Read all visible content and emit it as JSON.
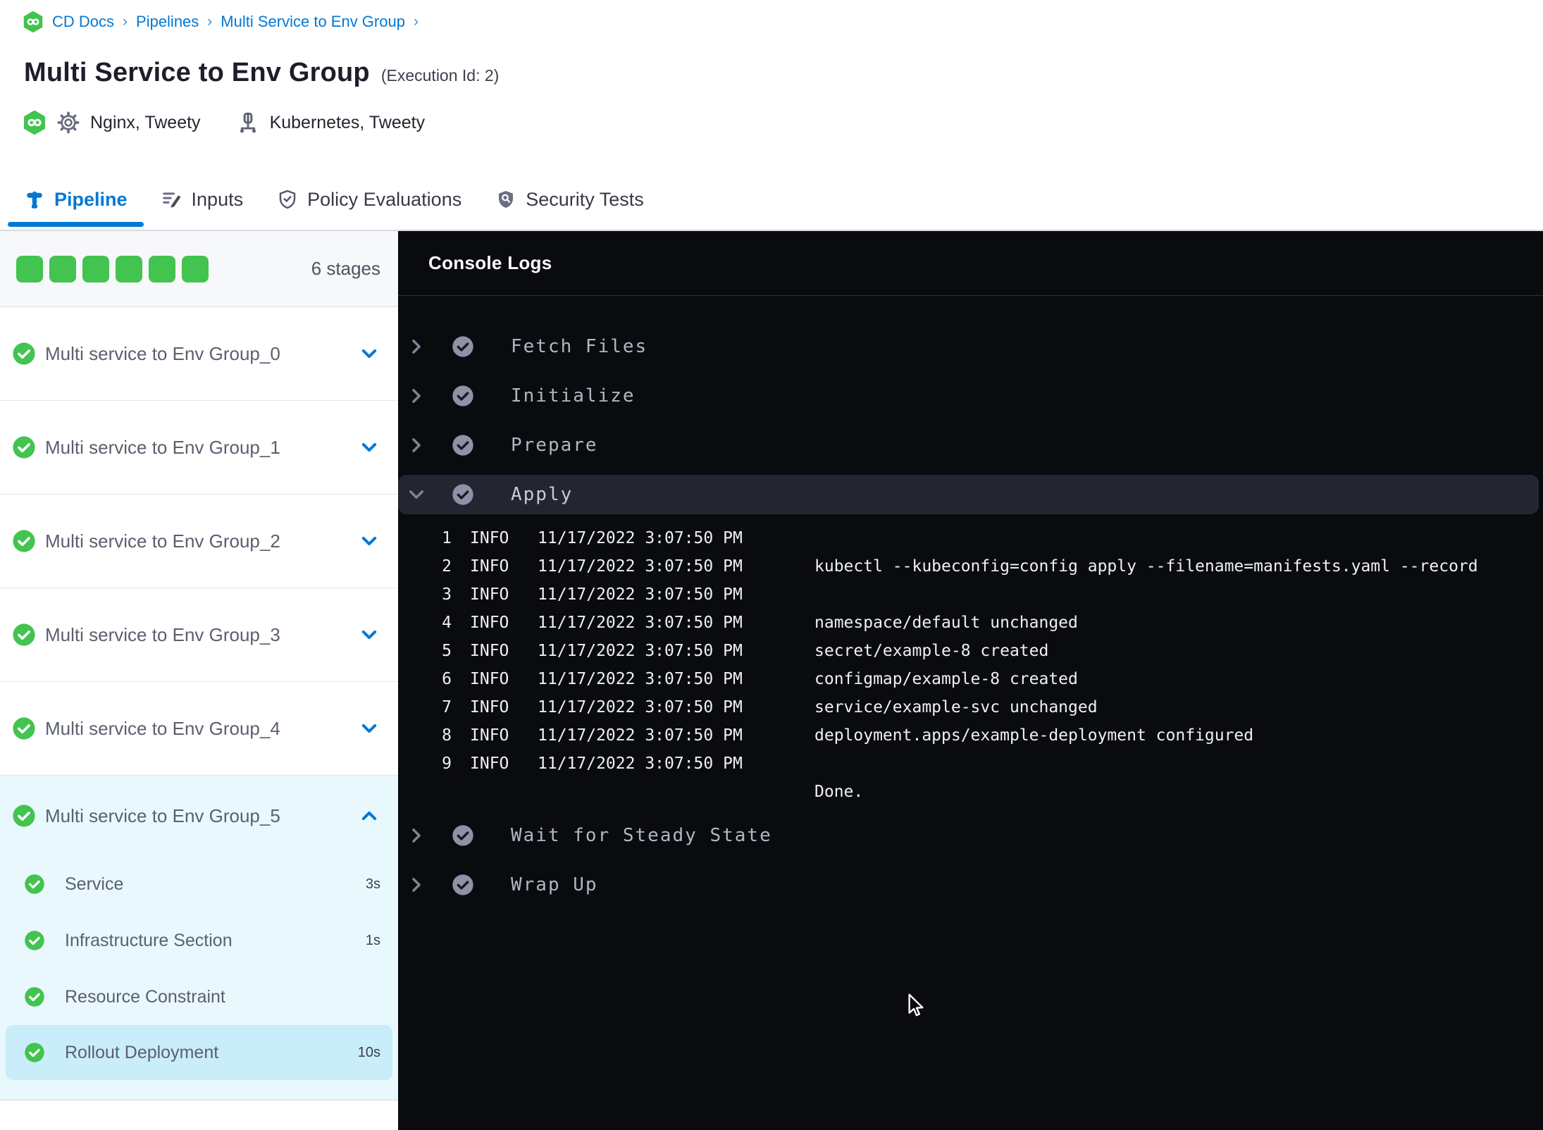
{
  "colors": {
    "accent_blue": "#0278d5",
    "success_green": "#43c34f",
    "console_bg": "#0a0b0e",
    "console_row_bg": "#232531",
    "stage_expanded_bg": "#e9f8fd",
    "stage_selected_bg": "#c9edf9"
  },
  "breadcrumb": {
    "logo_icon": "harness-cd-logo",
    "items": [
      "CD Docs",
      "Pipelines",
      "Multi Service to Env Group"
    ]
  },
  "header": {
    "title": "Multi Service to Env Group",
    "execution_id": "(Execution Id: 2)",
    "services": {
      "icon": "gear-icon",
      "label": "Nginx, Tweety"
    },
    "environments": {
      "icon": "infrastructure-icon",
      "label": "Kubernetes, Tweety"
    }
  },
  "tabs": [
    {
      "label": "Pipeline",
      "icon": "pipeline-icon",
      "active": true
    },
    {
      "label": "Inputs",
      "icon": "inputs-icon",
      "active": false
    },
    {
      "label": "Policy Evaluations",
      "icon": "policy-evaluations-icon",
      "active": false
    },
    {
      "label": "Security Tests",
      "icon": "security-tests-icon",
      "active": false
    }
  ],
  "sidebar": {
    "progress_square_count": 6,
    "stages_count_label": "6 stages",
    "stages": [
      {
        "name": "Multi service to Env Group_0",
        "status": "success",
        "expanded": false
      },
      {
        "name": "Multi service to Env Group_1",
        "status": "success",
        "expanded": false
      },
      {
        "name": "Multi service to Env Group_2",
        "status": "success",
        "expanded": false
      },
      {
        "name": "Multi service to Env Group_3",
        "status": "success",
        "expanded": false
      },
      {
        "name": "Multi service to Env Group_4",
        "status": "success",
        "expanded": false
      },
      {
        "name": "Multi service to Env Group_5",
        "status": "success",
        "expanded": true,
        "steps": [
          {
            "label": "Service",
            "duration": "3s",
            "selected": false
          },
          {
            "label": "Infrastructure Section",
            "duration": "1s",
            "selected": false
          },
          {
            "label": "Resource Constraint",
            "duration": "",
            "selected": false
          },
          {
            "label": "Rollout Deployment",
            "duration": "10s",
            "selected": true
          }
        ]
      }
    ]
  },
  "console": {
    "title": "Console Logs",
    "steps": [
      {
        "label": "Fetch Files",
        "status": "success",
        "expanded": false
      },
      {
        "label": "Initialize",
        "status": "success",
        "expanded": false
      },
      {
        "label": "Prepare",
        "status": "success",
        "expanded": false
      },
      {
        "label": "Apply",
        "status": "success",
        "expanded": true,
        "logs": [
          {
            "line": "1",
            "level": "INFO",
            "time": "11/17/2022 3:07:50 PM",
            "message": ""
          },
          {
            "line": "2",
            "level": "INFO",
            "time": "11/17/2022 3:07:50 PM",
            "message": "kubectl --kubeconfig=config apply --filename=manifests.yaml --record"
          },
          {
            "line": "3",
            "level": "INFO",
            "time": "11/17/2022 3:07:50 PM",
            "message": ""
          },
          {
            "line": "4",
            "level": "INFO",
            "time": "11/17/2022 3:07:50 PM",
            "message": "namespace/default unchanged"
          },
          {
            "line": "5",
            "level": "INFO",
            "time": "11/17/2022 3:07:50 PM",
            "message": "secret/example-8 created"
          },
          {
            "line": "6",
            "level": "INFO",
            "time": "11/17/2022 3:07:50 PM",
            "message": "configmap/example-8 created"
          },
          {
            "line": "7",
            "level": "INFO",
            "time": "11/17/2022 3:07:50 PM",
            "message": "service/example-svc unchanged"
          },
          {
            "line": "8",
            "level": "INFO",
            "time": "11/17/2022 3:07:50 PM",
            "message": "deployment.apps/example-deployment configured"
          },
          {
            "line": "9",
            "level": "INFO",
            "time": "11/17/2022 3:07:50 PM",
            "message": ""
          }
        ],
        "closing_message": "Done."
      },
      {
        "label": "Wait for Steady State",
        "status": "success",
        "expanded": false
      },
      {
        "label": "Wrap Up",
        "status": "success",
        "expanded": false
      }
    ]
  }
}
